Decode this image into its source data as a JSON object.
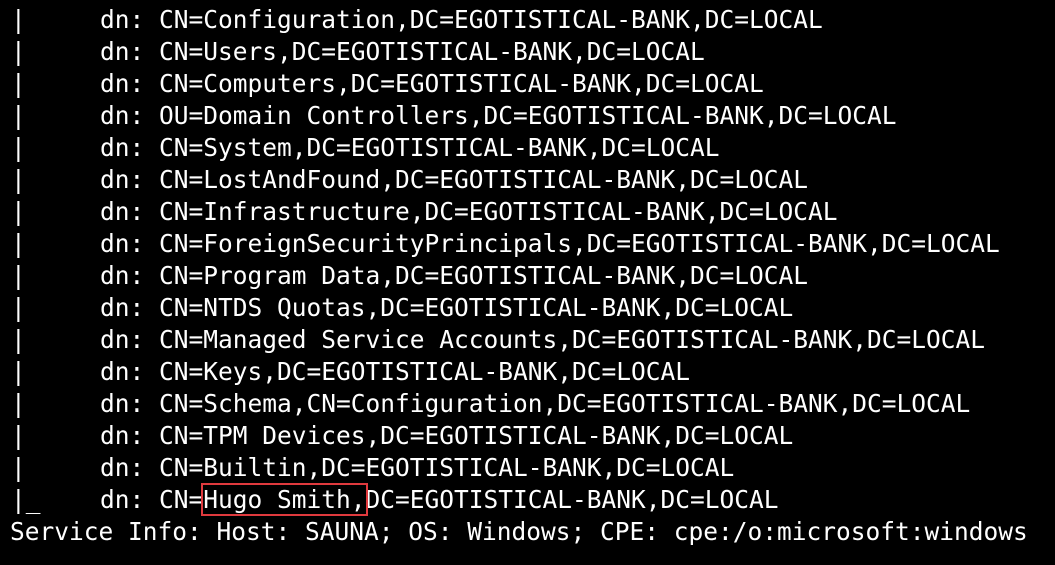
{
  "terminal": {
    "lines": [
      {
        "prefix": "|",
        "text": "dn: CN=Configuration,DC=EGOTISTICAL-BANK,DC=LOCAL"
      },
      {
        "prefix": "|",
        "text": "dn: CN=Users,DC=EGOTISTICAL-BANK,DC=LOCAL"
      },
      {
        "prefix": "|",
        "text": "dn: CN=Computers,DC=EGOTISTICAL-BANK,DC=LOCAL"
      },
      {
        "prefix": "|",
        "text": "dn: OU=Domain Controllers,DC=EGOTISTICAL-BANK,DC=LOCAL"
      },
      {
        "prefix": "|",
        "text": "dn: CN=System,DC=EGOTISTICAL-BANK,DC=LOCAL"
      },
      {
        "prefix": "|",
        "text": "dn: CN=LostAndFound,DC=EGOTISTICAL-BANK,DC=LOCAL"
      },
      {
        "prefix": "|",
        "text": "dn: CN=Infrastructure,DC=EGOTISTICAL-BANK,DC=LOCAL"
      },
      {
        "prefix": "|",
        "text": "dn: CN=ForeignSecurityPrincipals,DC=EGOTISTICAL-BANK,DC=LOCAL"
      },
      {
        "prefix": "|",
        "text": "dn: CN=Program Data,DC=EGOTISTICAL-BANK,DC=LOCAL"
      },
      {
        "prefix": "|",
        "text": "dn: CN=NTDS Quotas,DC=EGOTISTICAL-BANK,DC=LOCAL"
      },
      {
        "prefix": "|",
        "text": "dn: CN=Managed Service Accounts,DC=EGOTISTICAL-BANK,DC=LOCAL"
      },
      {
        "prefix": "|",
        "text": "dn: CN=Keys,DC=EGOTISTICAL-BANK,DC=LOCAL"
      },
      {
        "prefix": "|",
        "text": "dn: CN=Schema,CN=Configuration,DC=EGOTISTICAL-BANK,DC=LOCAL"
      },
      {
        "prefix": "|",
        "text": "dn: CN=TPM Devices,DC=EGOTISTICAL-BANK,DC=LOCAL"
      },
      {
        "prefix": "|",
        "text": "dn: CN=Builtin,DC=EGOTISTICAL-BANK,DC=LOCAL"
      }
    ],
    "last_entry": {
      "prefix": "|_",
      "before": "dn: CN=",
      "highlight": "Hugo Smith,",
      "after": "DC=EGOTISTICAL-BANK,DC=LOCAL"
    },
    "service_info": "Service Info: Host: SAUNA; OS: Windows; CPE: cpe:/o:microsoft:windows"
  },
  "colors": {
    "background": "#000000",
    "text": "#ffffff",
    "highlight_box": "#e03a3e"
  }
}
